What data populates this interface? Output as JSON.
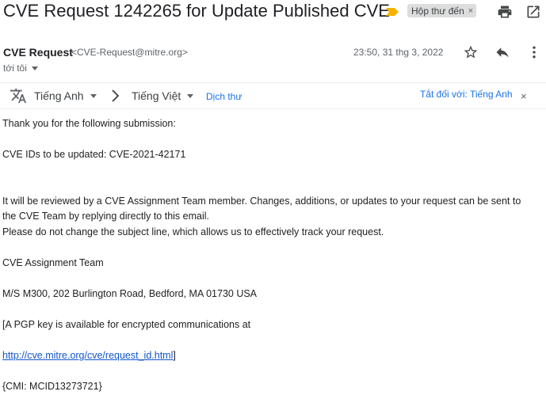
{
  "email": {
    "subject": "CVE Request 1242265 for Update Published CVE",
    "label": "Hộp thư đến",
    "label_close": "×",
    "sender_name": "CVE Request",
    "sender_email": "<CVE-Request@mitre.org>",
    "date": "23:50, 31 thg 3, 2022",
    "recipient": "tới tôi"
  },
  "toolbar": {
    "icons": [
      "print-icon",
      "open-in-new-window-icon",
      "star-icon",
      "reply-icon",
      "more-vert-icon"
    ]
  },
  "translate": {
    "source_lang": "Tiếng Anh",
    "target_lang": "Tiếng Việt",
    "translate_label": "Dịch thư",
    "turn_off_label": "Tắt đối với: Tiếng Anh",
    "close_label": "×"
  },
  "body": {
    "line1": "Thank you for the following submission:",
    "line2": "CVE IDs to be updated:  CVE-2021-42171",
    "line3": "It will be reviewed by a CVE Assignment Team member. Changes, additions, or updates to your request can be sent to",
    "line4": "the CVE Team by replying directly to this email.",
    "line5": "Please do not change the subject line, which allows us to effectively track your request.",
    "line6": "CVE Assignment Team",
    "line7": "M/S M300, 202 Burlington Road, Bedford, MA 01730 USA",
    "line8": "[A PGP key is available for encrypted communications at",
    "link": "http://cve.mitre.org/cve/request_id.html",
    "link_suffix": "]",
    "line10": "{CMI: MCID13273721}"
  },
  "colors": {
    "link": "#1a73e8",
    "body_link": "#1155cc",
    "importance_marker": "#f4b400",
    "label_chip_bg": "#dddddd"
  }
}
